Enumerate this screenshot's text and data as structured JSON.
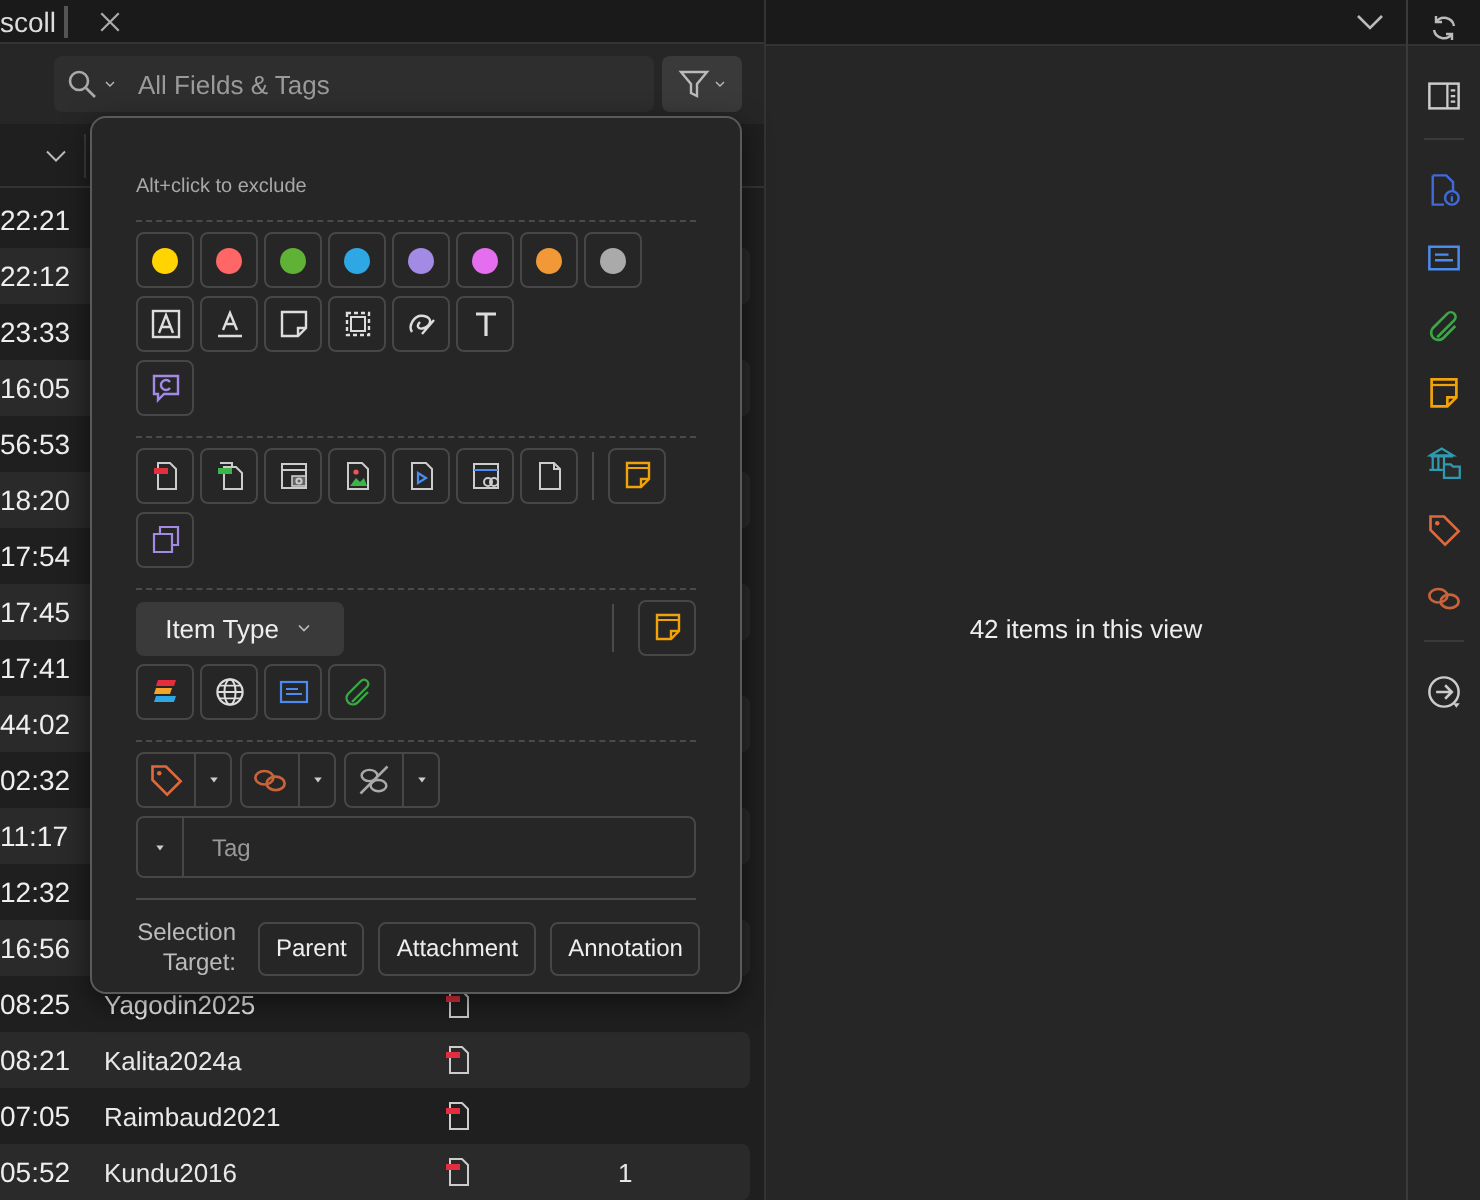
{
  "tab": {
    "title": "scoll"
  },
  "search": {
    "placeholder": "All Fields & Tags"
  },
  "rows": [
    {
      "time": "22:21"
    },
    {
      "time": "22:12"
    },
    {
      "time": "23:33"
    },
    {
      "time": "16:05"
    },
    {
      "time": "56:53"
    },
    {
      "time": "18:20"
    },
    {
      "time": "17:54"
    },
    {
      "time": "17:45"
    },
    {
      "time": "17:41"
    },
    {
      "time": "44:02"
    },
    {
      "time": "02:32"
    },
    {
      "time": "11:17"
    },
    {
      "time": "12:32"
    },
    {
      "time": "16:56"
    },
    {
      "time": "08:25",
      "title": "Yagodin2025",
      "has_pdf": true
    },
    {
      "time": "08:21",
      "title": "Kalita2024a",
      "has_pdf": true
    },
    {
      "time": "07:05",
      "title": "Raimbaud2021",
      "has_pdf": true
    },
    {
      "time": "05:52",
      "title": "Kundu2016",
      "has_pdf": true,
      "notes": "1"
    }
  ],
  "filter_popup": {
    "hint": "Alt+click to exclude",
    "colors": [
      {
        "color": "#ffd400"
      },
      {
        "color": "#ff6666"
      },
      {
        "color": "#5fb236"
      },
      {
        "color": "#2ea8e5"
      },
      {
        "color": "#a28ae5"
      },
      {
        "color": "#e56eee"
      },
      {
        "color": "#f19837"
      },
      {
        "color": "#aaaaaa"
      }
    ],
    "item_type_button": "Item Type",
    "tag_field": {
      "placeholder": "Tag"
    },
    "selection_label": "Selection Target:",
    "selection_targets": [
      {
        "label": "Parent"
      },
      {
        "label": "Attachment"
      },
      {
        "label": "Annotation"
      }
    ]
  },
  "item_pane": {
    "message": "42 items in this view"
  }
}
